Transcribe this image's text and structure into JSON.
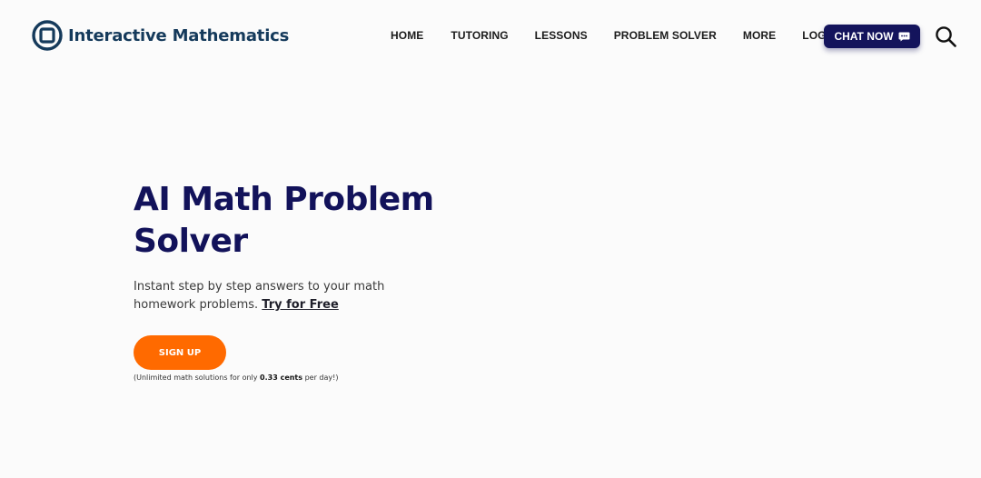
{
  "header": {
    "brand": "Interactive Mathematics",
    "nav": [
      {
        "label": "HOME"
      },
      {
        "label": "TUTORING"
      },
      {
        "label": "LESSONS"
      },
      {
        "label": "PROBLEM SOLVER"
      },
      {
        "label": "MORE"
      },
      {
        "label": "LOGIN"
      }
    ],
    "chat_label": "CHAT NOW",
    "chat_icon": "chat-bubble-icon",
    "search_icon": "search-icon"
  },
  "hero": {
    "title": "AI Math Problem Solver",
    "subtitle": "Instant step by step answers to your math homework problems.",
    "try_link": "Try for Free",
    "signup_label": "SIGN UP",
    "note_prefix": "(Unlimited math solutions for only",
    "note_price": "0.33 cents",
    "note_suffix": "per day!)"
  },
  "colors": {
    "brand_navy": "#14145c",
    "logo_blue": "#153a5b",
    "accent_orange": "#ff6a00",
    "background": "#fbfbfb"
  }
}
